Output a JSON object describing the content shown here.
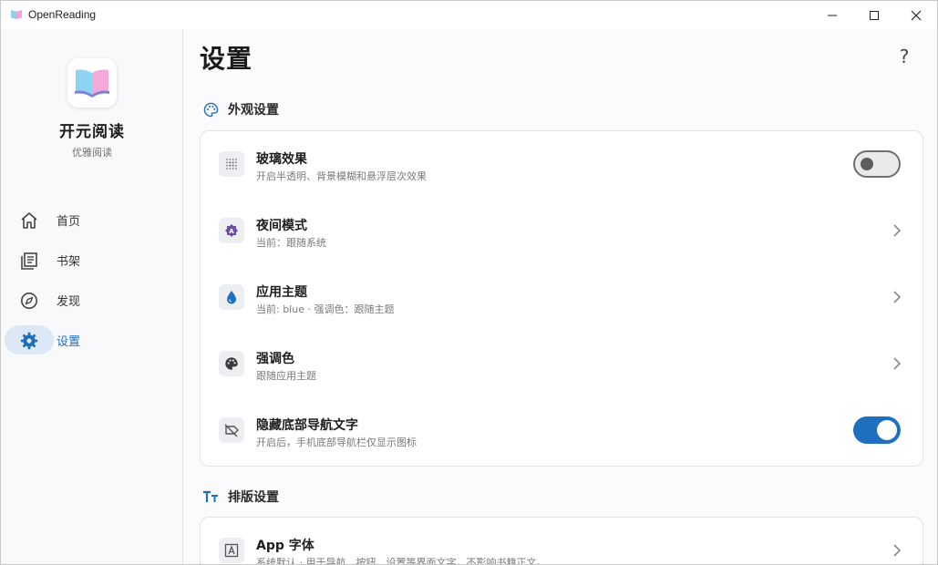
{
  "window": {
    "title": "OpenReading"
  },
  "sidebar": {
    "brand_name": "开元阅读",
    "brand_sub": "优雅阅读",
    "items": [
      {
        "label": "首页",
        "icon": "home-icon"
      },
      {
        "label": "书架",
        "icon": "bookshelf-icon"
      },
      {
        "label": "发现",
        "icon": "compass-icon"
      },
      {
        "label": "设置",
        "icon": "gear-icon",
        "active": true
      }
    ]
  },
  "main": {
    "title": "设置",
    "help": "?",
    "sections": [
      {
        "label": "外观设置",
        "icon": "palette-icon",
        "rows": [
          {
            "title": "玻璃效果",
            "sub": "开启半透明、背景模糊和悬浮层次效果",
            "icon": "blur-grid-icon",
            "control": "toggle",
            "toggle_on": false
          },
          {
            "title": "夜间模式",
            "sub": "当前：跟随系统",
            "icon": "night-mode-icon",
            "control": "chevron"
          },
          {
            "title": "应用主题",
            "sub": "当前: blue · 强调色：跟随主题",
            "icon": "water-drop-icon",
            "control": "chevron"
          },
          {
            "title": "强调色",
            "sub": "跟随应用主题",
            "icon": "palette-icon",
            "control": "chevron"
          },
          {
            "title": "隐藏底部导航文字",
            "sub": "开启后，手机底部导航栏仅显示图标",
            "icon": "label-off-icon",
            "control": "toggle",
            "toggle_on": true
          }
        ]
      },
      {
        "label": "排版设置",
        "icon": "text-size-icon",
        "rows": [
          {
            "title": "App 字体",
            "sub": "系统默认 · 用于导航、按钮、设置等界面文字，不影响书籍正文。",
            "icon": "font-icon",
            "control": "chevron"
          }
        ]
      }
    ]
  },
  "colors": {
    "accent": "#1f6fc1",
    "active_pill": "#dce8f6"
  }
}
